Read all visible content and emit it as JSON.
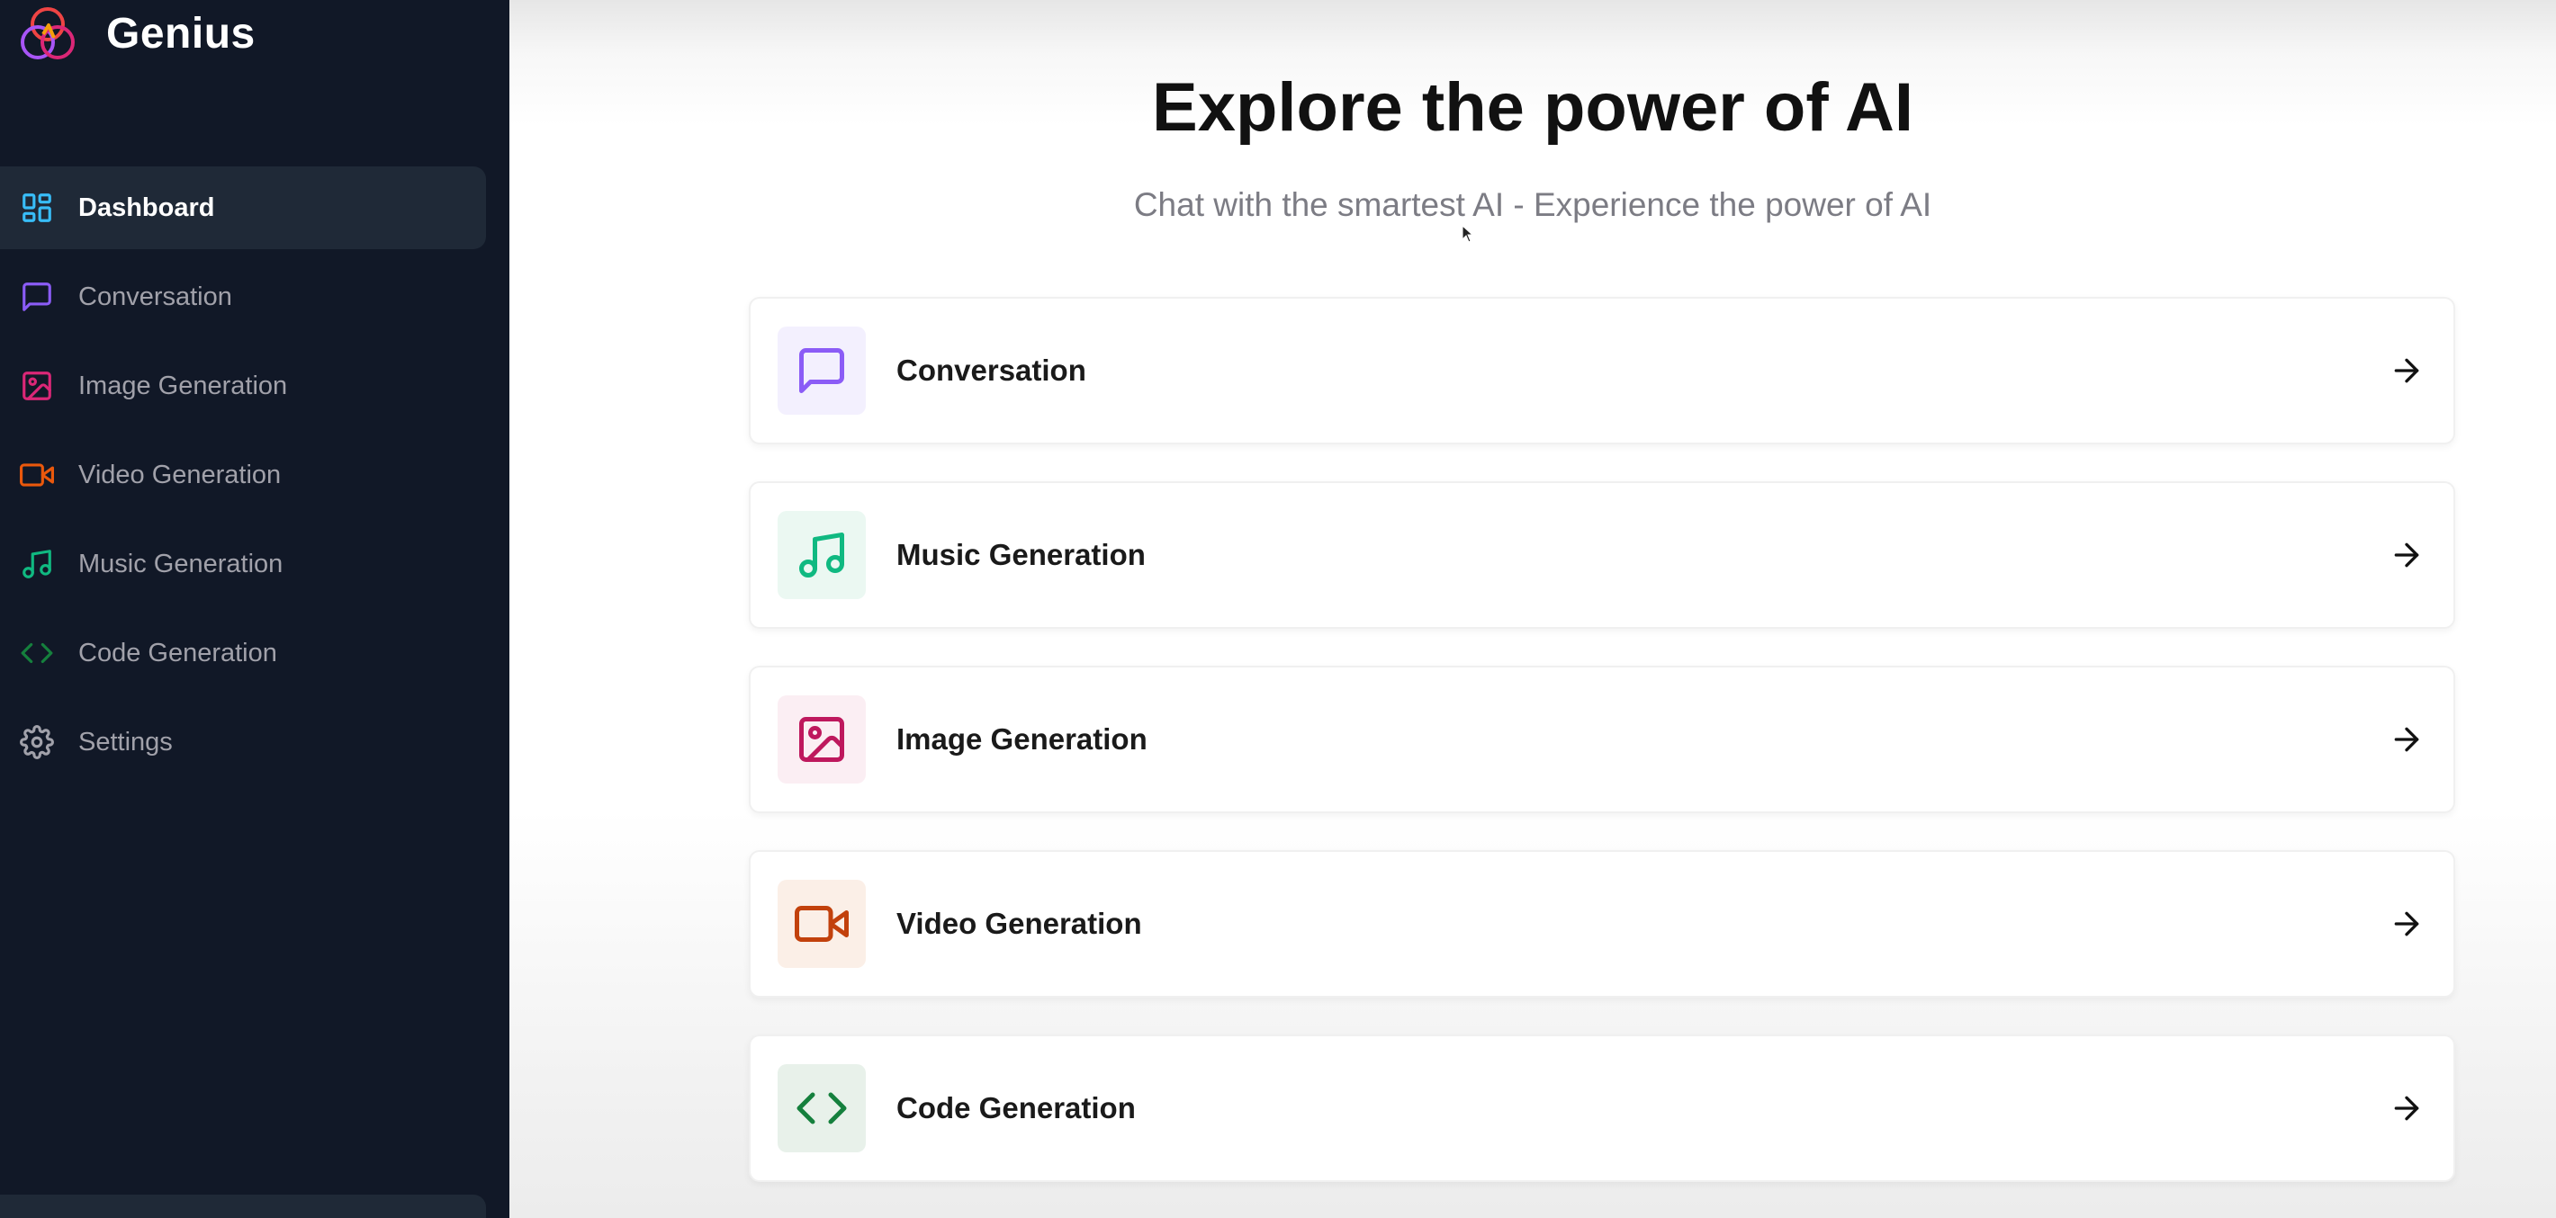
{
  "app": {
    "name": "Genius"
  },
  "sidebar": {
    "items": [
      {
        "label": "Dashboard",
        "icon": "layout-dashboard-icon",
        "color": "#38bdf8",
        "active": true
      },
      {
        "label": "Conversation",
        "icon": "message-square-icon",
        "color": "#8b5cf6",
        "active": false
      },
      {
        "label": "Image Generation",
        "icon": "image-icon",
        "color": "#db2777",
        "active": false
      },
      {
        "label": "Video Generation",
        "icon": "video-icon",
        "color": "#ea580c",
        "active": false
      },
      {
        "label": "Music Generation",
        "icon": "music-icon",
        "color": "#10b981",
        "active": false
      },
      {
        "label": "Code Generation",
        "icon": "code-icon",
        "color": "#15803d",
        "active": false
      },
      {
        "label": "Settings",
        "icon": "settings-icon",
        "color": "#a1a1aa",
        "active": false
      }
    ]
  },
  "main": {
    "title": "Explore the power of AI",
    "subtitle": "Chat with the smartest AI - Experience the power of AI",
    "cards": [
      {
        "label": "Conversation",
        "icon": "message-square-icon",
        "color": "#8b5cf6",
        "bg": "#f3f0fe"
      },
      {
        "label": "Music Generation",
        "icon": "music-icon",
        "color": "#10b981",
        "bg": "#ebf8f2"
      },
      {
        "label": "Image Generation",
        "icon": "image-icon",
        "color": "#be185d",
        "bg": "#fbeef3"
      },
      {
        "label": "Video Generation",
        "icon": "video-icon",
        "color": "#c2410c",
        "bg": "#fbefe7"
      },
      {
        "label": "Code Generation",
        "icon": "code-icon",
        "color": "#15803d",
        "bg": "#e8f1ea"
      }
    ]
  }
}
